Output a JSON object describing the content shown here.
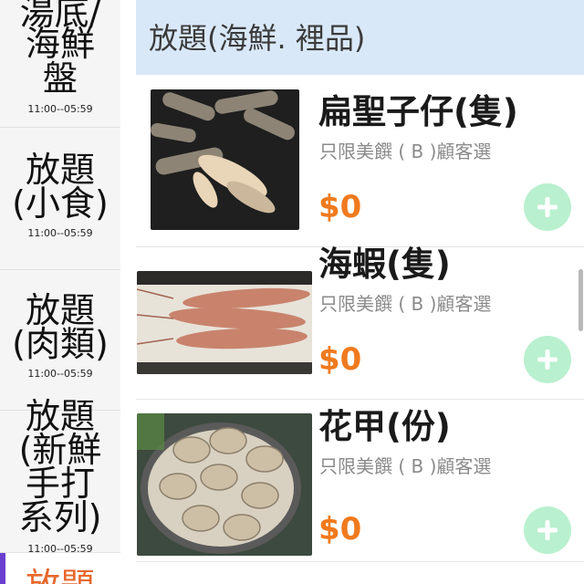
{
  "sidebar": {
    "categories": [
      {
        "label_lines": [
          "湯底/",
          "海鮮",
          "盤"
        ],
        "time": "11:00--05:59"
      },
      {
        "label_lines": [
          "放題",
          "(小食)"
        ],
        "time": "11:00--05:59"
      },
      {
        "label_lines": [
          "放題",
          "(肉類)"
        ],
        "time": "11:00--05:59"
      },
      {
        "label_lines": [
          "放題",
          "(新鮮",
          "手打",
          "系列)"
        ],
        "time": "11:00--05:59"
      },
      {
        "label_lines": [
          "放題"
        ],
        "time": ""
      }
    ]
  },
  "section": {
    "title": "放題(海鮮. 裡品)"
  },
  "items": [
    {
      "name": "扁聖子仔(隻)",
      "note": "只限美饌 ( B )顧客選",
      "price": "$0",
      "add_icon": "plus-icon"
    },
    {
      "name": "海蝦(隻)",
      "note": "只限美饌 ( B )顧客選",
      "price": "$0",
      "add_icon": "plus-icon"
    },
    {
      "name": "花甲(份)",
      "note": "只限美饌 ( B )顧客選",
      "price": "$0",
      "add_icon": "plus-icon"
    }
  ],
  "colors": {
    "accent_price": "#f07a1e",
    "add_button": "#b9f0cf",
    "header_bg": "#d9e8f8",
    "active_bar": "#6a3fd0"
  }
}
